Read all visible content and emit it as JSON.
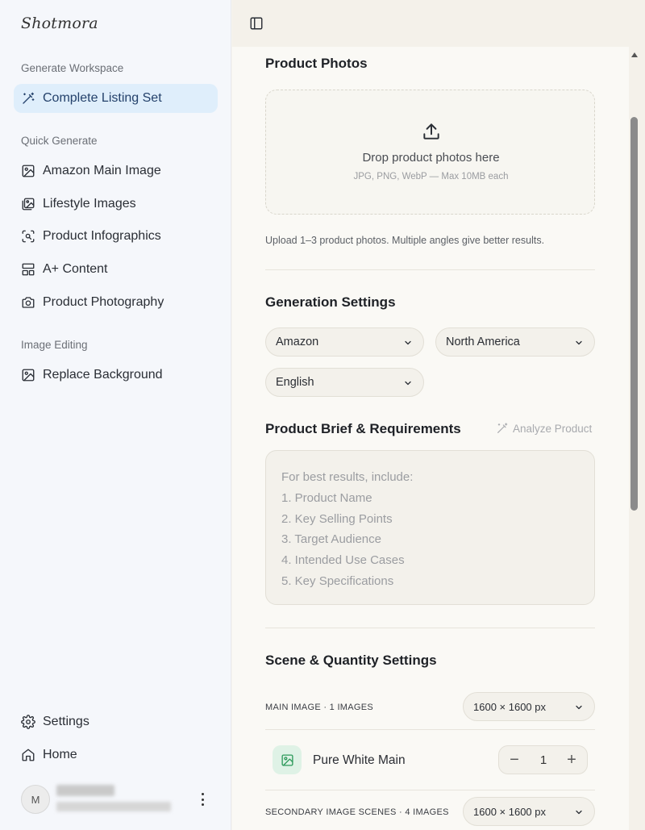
{
  "app": {
    "brand": "Shotmora"
  },
  "sidebar": {
    "sections": [
      {
        "label": "Generate Workspace"
      },
      {
        "label": "Quick Generate"
      },
      {
        "label": "Image Editing"
      }
    ],
    "items": [
      {
        "label": "Complete Listing Set",
        "icon": "magic-wand-icon",
        "active": true
      },
      {
        "label": "Amazon Main Image",
        "icon": "image-icon"
      },
      {
        "label": "Lifestyle Images",
        "icon": "images-icon"
      },
      {
        "label": "Product Infographics",
        "icon": "scan-icon"
      },
      {
        "label": "A+ Content",
        "icon": "layout-icon"
      },
      {
        "label": "Product Photography",
        "icon": "camera-icon"
      },
      {
        "label": "Replace Background",
        "icon": "image-icon"
      }
    ],
    "footer": [
      {
        "label": "Settings",
        "icon": "gear-icon"
      },
      {
        "label": "Home",
        "icon": "home-icon"
      }
    ],
    "user": {
      "avatar_initial": "M"
    }
  },
  "main": {
    "product_photos": {
      "title": "Product Photos",
      "dropzone_title": "Drop product photos here",
      "dropzone_sub": "JPG, PNG, WebP — Max 10MB each",
      "helper": "Upload 1–3 product photos. Multiple angles give better results."
    },
    "generation_settings": {
      "title": "Generation Settings",
      "platform": "Amazon",
      "region": "North America",
      "language": "English"
    },
    "brief": {
      "title": "Product Brief & Requirements",
      "analyze_label": "Analyze Product",
      "placeholder_lines": [
        "For best results, include:",
        "1. Product Name",
        "2. Key Selling Points",
        "3. Target Audience",
        "4. Intended Use Cases",
        "5. Key Specifications"
      ]
    },
    "scene_settings": {
      "title": "Scene & Quantity Settings",
      "main_image_label": "MAIN IMAGE · 1 IMAGES",
      "main_image_size": "1600 × 1600 px",
      "scene_name": "Pure White Main",
      "scene_qty": "1",
      "minus": "−",
      "plus": "+",
      "secondary_label": "SECONDARY IMAGE SCENES · 4 IMAGES",
      "secondary_size": "1600 × 1600 px"
    }
  },
  "colors": {
    "sidebar_bg": "#f5f7fb",
    "active_bg": "#dfeefb",
    "main_bg": "#faf9f5",
    "scene_icon_bg": "#dff2e6",
    "scene_icon_fg": "#2e9a5b"
  }
}
